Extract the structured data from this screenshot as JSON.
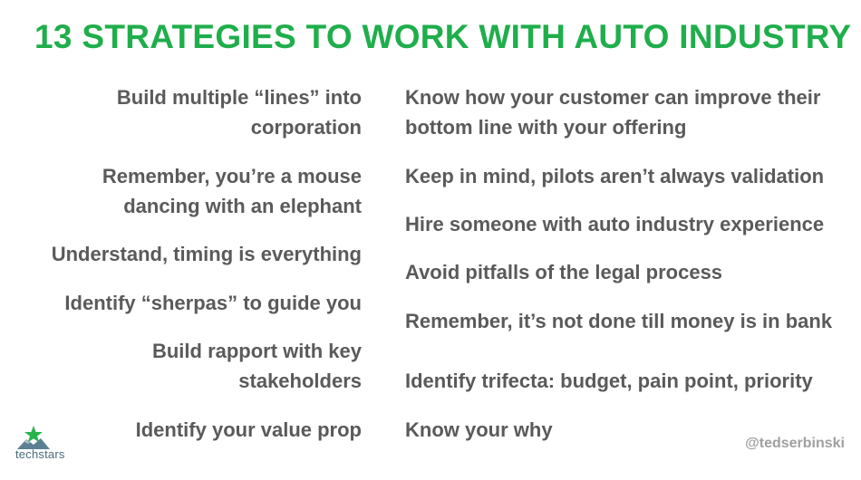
{
  "title": "13 STRATEGIES TO WORK WITH AUTO INDUSTRY",
  "left_items": [
    [
      "Build multiple “lines” into",
      "corporation"
    ],
    [
      "Remember, you’re a mouse",
      "dancing with an elephant"
    ],
    [
      "Understand, timing is everything"
    ],
    [
      "Identify “sherpas” to guide you"
    ],
    [
      "Build rapport with key",
      "stakeholders"
    ],
    [
      "Identify your value prop"
    ]
  ],
  "right_items": [
    [
      "Know how your customer can improve their",
      "bottom line with your offering"
    ],
    [
      "Keep in mind, pilots aren’t always validation"
    ],
    [
      "Hire someone with auto industry experience"
    ],
    [
      "Avoid pitfalls of the legal process"
    ],
    [
      "Remember, it’s not done till money is in bank"
    ],
    [
      "Identify trifecta: budget, pain point, priority"
    ],
    [
      "Know your why"
    ]
  ],
  "logo_text": "techstars",
  "handle": "@tedserbinski",
  "colors": {
    "title": "#1fae4b",
    "text": "#5a5a5a",
    "handle": "#a0a0a0"
  }
}
